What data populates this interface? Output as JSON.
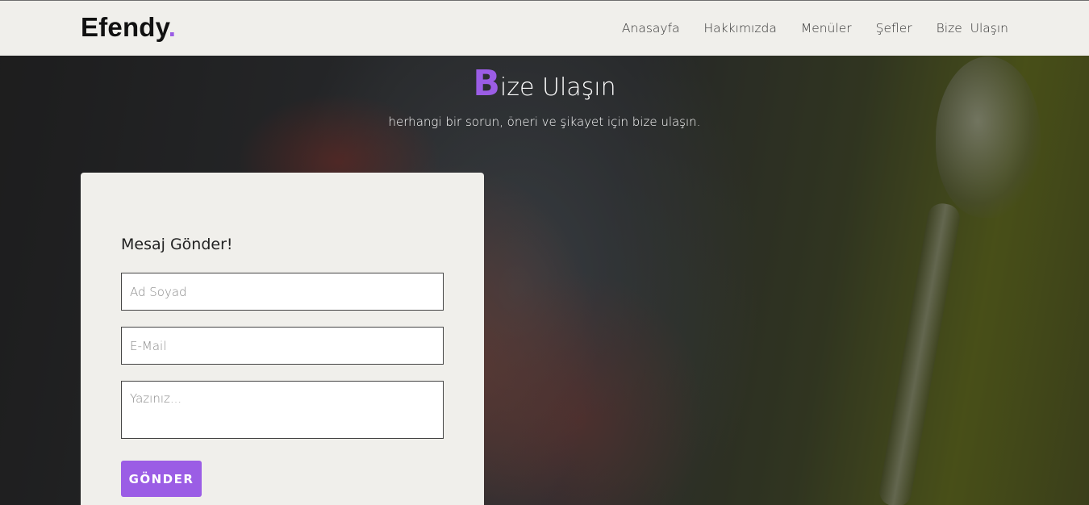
{
  "brand": {
    "name": "Efendy",
    "dot": ".",
    "accent_color": "#9b5de5"
  },
  "nav": {
    "items": [
      {
        "label": "Anasayfa"
      },
      {
        "label": "Hakkımızda"
      },
      {
        "label": "Menüler"
      },
      {
        "label": "Şefler"
      },
      {
        "label": "Bize  Ulaşın"
      }
    ]
  },
  "hero": {
    "title_initial": "B",
    "title_rest": "ize Ulaşın",
    "subtitle": "herhangi bir sorun, öneri ve şikayet için bize ulaşın."
  },
  "form": {
    "title": "Mesaj Gönder!",
    "name_placeholder": "Ad Soyad",
    "email_placeholder": "E-Mail",
    "message_placeholder": "Yazınız...",
    "submit_label": "GÖNDER"
  }
}
